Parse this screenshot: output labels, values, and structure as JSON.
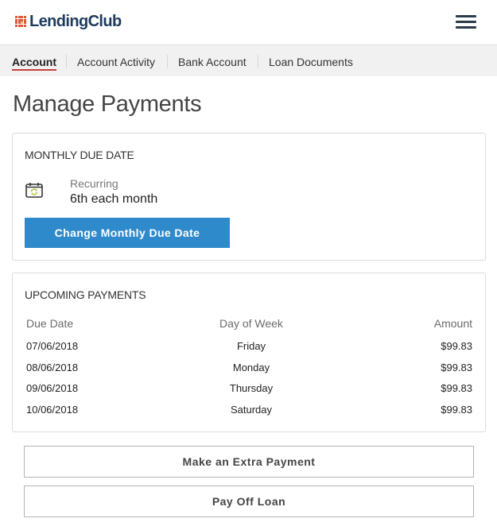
{
  "header": {
    "brand": "LendingClub",
    "logo_icon": "grid-squares-logo-icon",
    "menu_icon": "hamburger-menu-icon"
  },
  "subnav": {
    "items": [
      {
        "label": "Account",
        "active": true
      },
      {
        "label": "Account Activity",
        "active": false
      },
      {
        "label": "Bank Account",
        "active": false
      },
      {
        "label": "Loan Documents",
        "active": false
      }
    ],
    "active_underline_color": "#c4403b"
  },
  "page": {
    "title": "Manage Payments"
  },
  "monthly_due_date": {
    "title": "MONTHLY DUE DATE",
    "icon": "calendar-recurring-icon",
    "recurring_label": "Recurring",
    "recurring_value": "6th each month",
    "change_button_label": "Change Monthly Due Date",
    "button_color": "#2f8acb"
  },
  "upcoming_payments": {
    "title": "UPCOMING PAYMENTS",
    "columns": [
      "Due Date",
      "Day of Week",
      "Amount"
    ],
    "rows": [
      {
        "due_date": "07/06/2018",
        "day": "Friday",
        "amount": "$99.83"
      },
      {
        "due_date": "08/06/2018",
        "day": "Monday",
        "amount": "$99.83"
      },
      {
        "due_date": "09/06/2018",
        "day": "Thursday",
        "amount": "$99.83"
      },
      {
        "due_date": "10/06/2018",
        "day": "Saturday",
        "amount": "$99.83"
      }
    ]
  },
  "actions": {
    "extra_payment_label": "Make an Extra Payment",
    "pay_off_label": "Pay Off Loan"
  }
}
